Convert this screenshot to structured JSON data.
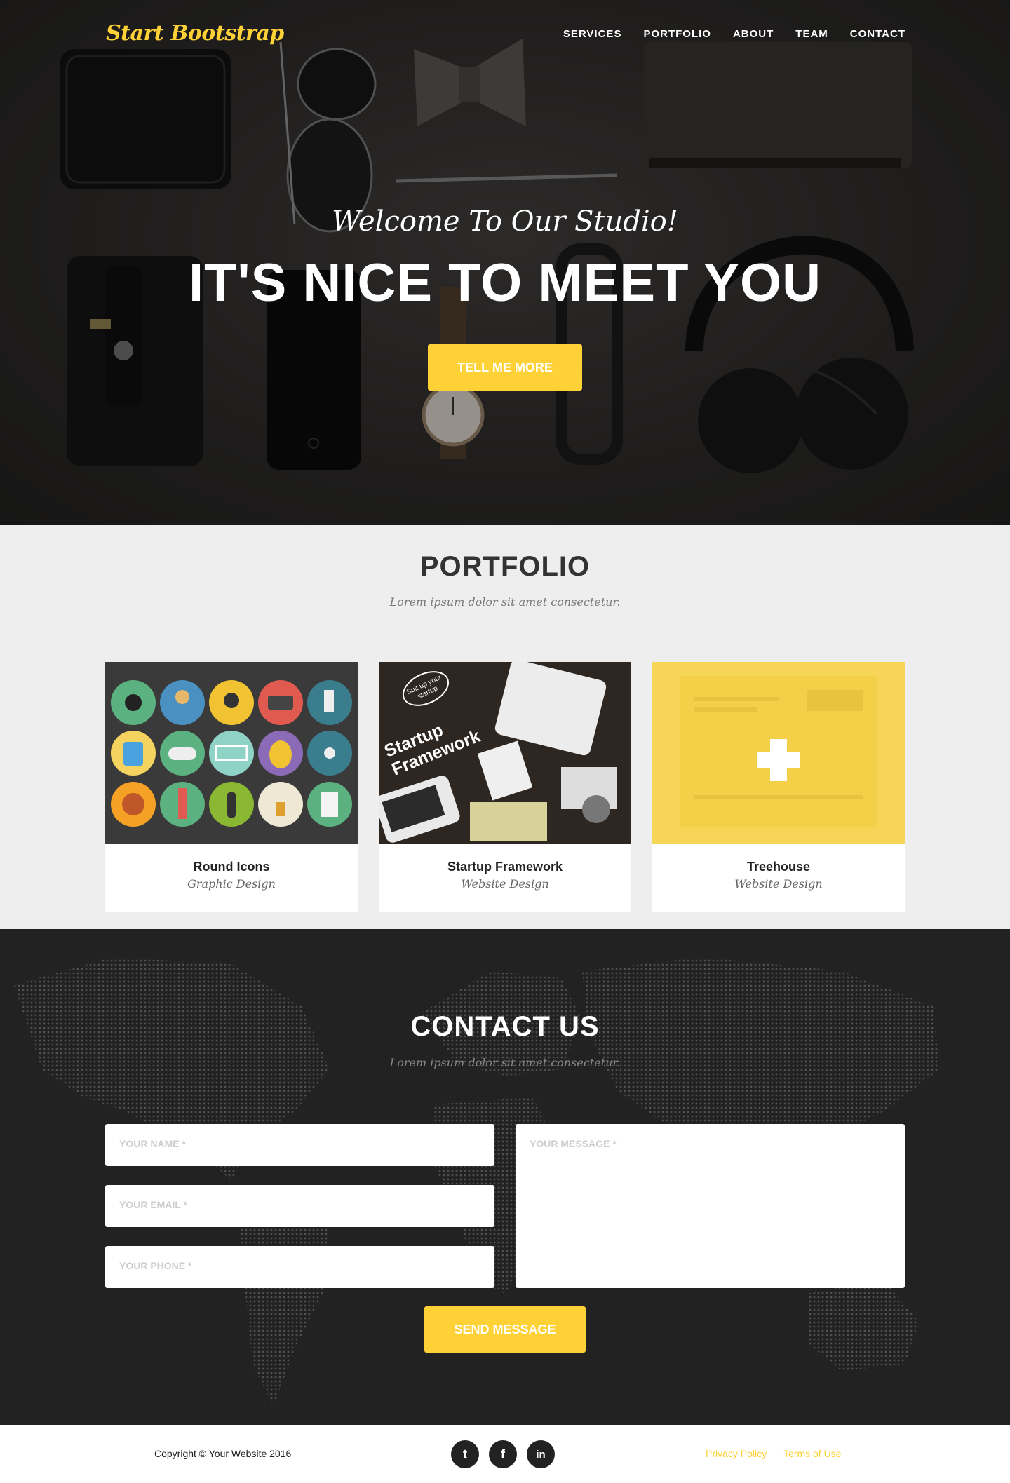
{
  "brand": {
    "name": "Start Bootstrap",
    "color": "#fed136"
  },
  "nav": {
    "items": [
      {
        "label": "SERVICES"
      },
      {
        "label": "PORTFOLIO"
      },
      {
        "label": "ABOUT"
      },
      {
        "label": "TEAM"
      },
      {
        "label": "CONTACT"
      }
    ]
  },
  "hero": {
    "lead": "Welcome To Our Studio!",
    "heading": "IT'S NICE TO MEET YOU",
    "button_label": "TELL ME MORE"
  },
  "portfolio": {
    "title": "PORTFOLIO",
    "subtitle": "Lorem ipsum dolor sit amet consectetur.",
    "items": [
      {
        "title": "Round Icons",
        "category": "Graphic Design"
      },
      {
        "title": "Startup Framework",
        "category": "Website Design",
        "thumb_badge": "Suit up your startup",
        "thumb_text": "Startup Framework"
      },
      {
        "title": "Treehouse",
        "category": "Website Design"
      }
    ]
  },
  "contact": {
    "title": "CONTACT US",
    "subtitle": "Lorem ipsum dolor sit amet consectetur.",
    "name_placeholder": "YOUR NAME *",
    "email_placeholder": "YOUR EMAIL *",
    "phone_placeholder": "YOUR PHONE *",
    "message_placeholder": "YOUR MESSAGE *",
    "send_label": "SEND MESSAGE"
  },
  "footer": {
    "copyright": "Copyright © Your Website 2016",
    "social": [
      {
        "icon": "twitter-icon",
        "glyph": "t"
      },
      {
        "icon": "facebook-icon",
        "glyph": "f"
      },
      {
        "icon": "linkedin-icon",
        "glyph": "in"
      }
    ],
    "privacy": "Privacy Policy",
    "terms": "Terms of Use"
  },
  "colors": {
    "accent": "#fed136",
    "dark": "#222222",
    "light_bg": "#eeeeee"
  }
}
